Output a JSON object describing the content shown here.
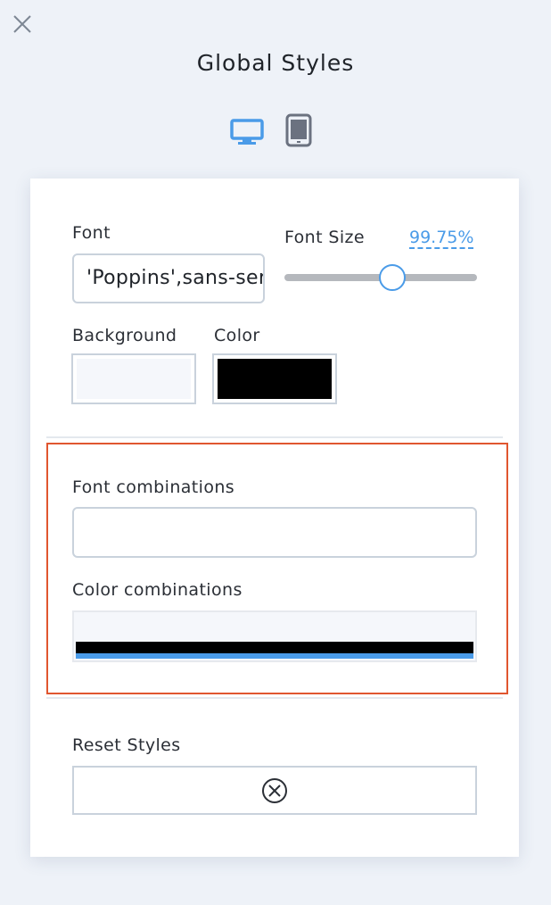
{
  "header": {
    "title": "Global Styles",
    "close_icon": "close-icon",
    "devices": [
      {
        "icon": "desktop-icon",
        "active": true,
        "color": "#4a9be8"
      },
      {
        "icon": "tablet-icon",
        "active": false,
        "color": "#6b7280"
      }
    ]
  },
  "panel": {
    "font": {
      "label": "Font",
      "value": "'Poppins',sans-serif"
    },
    "font_size": {
      "label": "Font Size",
      "value": "99.75%",
      "slider_level": 0.56
    },
    "background": {
      "label": "Background",
      "color": "#f5f7fb"
    },
    "color": {
      "label": "Color",
      "color": "#000000"
    },
    "combinations": {
      "font_label": "Font combinations",
      "font_value": "",
      "color_label": "Color combinations",
      "palette": [
        "#f5f7fb",
        "#000000",
        "#4a9be8"
      ],
      "highlight_color": "#e0562f"
    },
    "reset": {
      "label": "Reset Styles",
      "icon": "circle-x-icon"
    }
  }
}
